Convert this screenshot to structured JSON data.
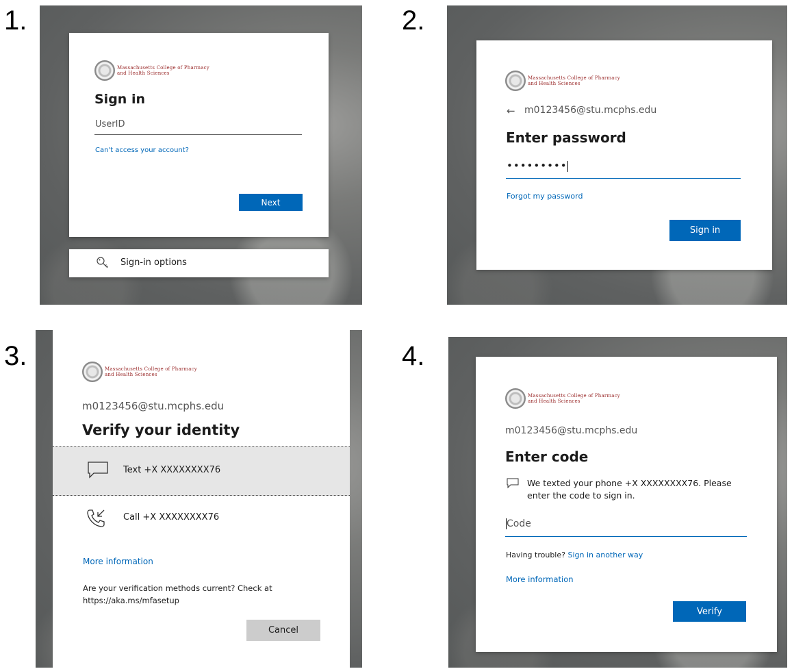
{
  "labels": {
    "one": "1.",
    "two": "2.",
    "three": "3.",
    "four": "4."
  },
  "brand": {
    "line1": "Massachusetts College of Pharmacy",
    "line2": "and Health Sciences"
  },
  "step1": {
    "title": "Sign in",
    "userid_placeholder": "UserID",
    "cant_access": "Can't access your account?",
    "next": "Next",
    "signin_options": "Sign-in options"
  },
  "step2": {
    "email": "m0123456@stu.mcphs.edu",
    "title": "Enter password",
    "password_mask": "•••••••••",
    "forgot": "Forgot my password",
    "signin": "Sign in"
  },
  "step3": {
    "email": "m0123456@stu.mcphs.edu",
    "title": "Verify your identity",
    "text_option": "Text +X XXXXXXXX76",
    "call_option": "Call +X XXXXXXXX76",
    "more_info": "More information",
    "methods_note_1": "Are your verification methods current? Check at",
    "methods_note_2": "https://aka.ms/mfasetup",
    "cancel": "Cancel"
  },
  "step4": {
    "email": "m0123456@stu.mcphs.edu",
    "title": "Enter code",
    "texted_1": "We texted your phone +X XXXXXXXX76. Please",
    "texted_2": "enter the code to sign in.",
    "code_placeholder": "Code",
    "trouble": "Having trouble?",
    "another_way": "Sign in another way",
    "more_info": "More information",
    "verify": "Verify"
  }
}
